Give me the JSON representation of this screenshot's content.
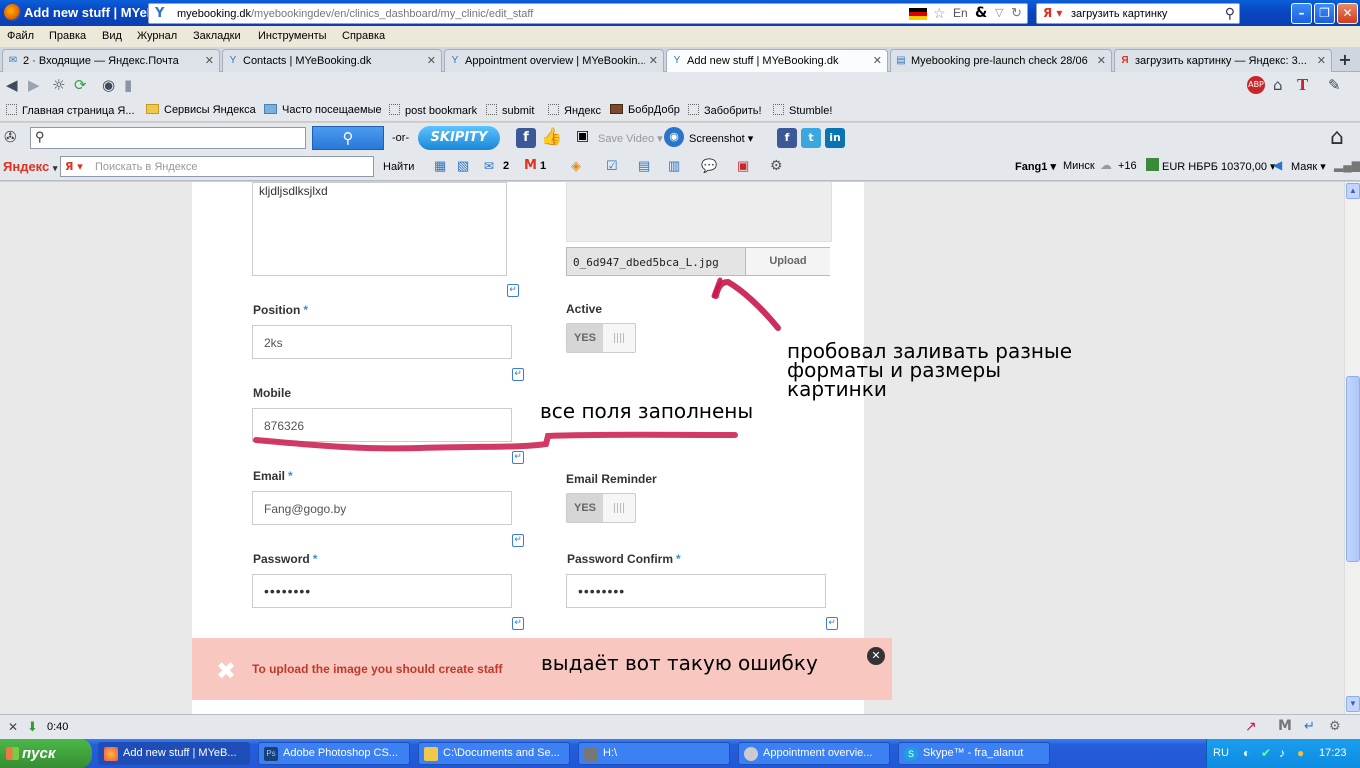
{
  "window": {
    "title": "Add new stuff | MYeBooking.dk - Mozilla Firefox"
  },
  "menu": [
    "Файл",
    "Правка",
    "Вид",
    "Журнал",
    "Закладки",
    "Инструменты",
    "Справка"
  ],
  "tabs": [
    {
      "label": "2 · Входящие — Яндекс.Почта"
    },
    {
      "label": "Contacts | MYeBooking.dk"
    },
    {
      "label": "Appointment overview | MYeBookin..."
    },
    {
      "label": "Add new stuff | MYeBooking.dk"
    },
    {
      "label": "Myebooking pre-launch check 28/06"
    },
    {
      "label": "загрузить картинку — Яндекс: 3..."
    }
  ],
  "address": {
    "host": "myebooking.dk",
    "path": "/myebookingdev/en/clinics_dashboard/my_clinic/edit_staff"
  },
  "browser_search": {
    "value": "загрузить картинку"
  },
  "bookmarks": [
    "Главная страница Я...",
    "Сервисы Яндекса",
    "Часто посещаемые",
    "post bookmark",
    "submit",
    "Яндекс",
    "БобрДобр",
    "Забобрить!",
    "Stumble!"
  ],
  "toolbar2": {
    "or_label": "-or-",
    "skipity": "SKIPITY",
    "save_video": "Save Video",
    "screenshot": "Screenshot"
  },
  "yandex_bar": {
    "brand": "Яндекс",
    "search_placeholder": "Поискать в Яндексе",
    "find": "Найти",
    "mail_count": "2",
    "gmail_count": "1",
    "user": "Fang1",
    "city": "Минск",
    "temp": "+16",
    "rate": "EUR НБРБ 10370,00",
    "radio": "Маяк"
  },
  "form": {
    "textarea_value": "kljdljsdlksjlxd",
    "file_name": "0_6d947_dbed5bca_L.jpg",
    "upload_label": "Upload",
    "position_label": "Position",
    "position_value": "2ks",
    "active_label": "Active",
    "active_toggle": "YES",
    "mobile_label": "Mobile",
    "mobile_value": "876326",
    "email_label": "Email",
    "email_value": "Fang@gogo.by",
    "email_reminder_label": "Email Reminder",
    "email_reminder_toggle": "YES",
    "password_label": "Password",
    "password_value": "••••••••",
    "password_confirm_label": "Password Confirm",
    "password_confirm_value": "••••••••",
    "required_mark": "*"
  },
  "error": {
    "message": "To upload the image you should create staff"
  },
  "annotations": {
    "tried": "пробовал заливать разные\nформаты и размеры\nкартинки",
    "filled": "все поля заполнены",
    "error": "выдаёт вот такую ошибку"
  },
  "status": {
    "time": "0:40"
  },
  "taskbar": {
    "start": "пуск",
    "items": [
      "Add new stuff | MYeB...",
      "Adobe Photoshop CS...",
      "C:\\Documents and Se...",
      "H:\\",
      "Appointment overvie...",
      "Skype™ - fra_alanut"
    ],
    "lang": "RU",
    "clock": "17:23"
  },
  "colors": {
    "annotation_stroke": "#c8184a",
    "error_bg": "#f8c8c0",
    "error_text": "#c0392b",
    "required": "#3a8ed8"
  }
}
